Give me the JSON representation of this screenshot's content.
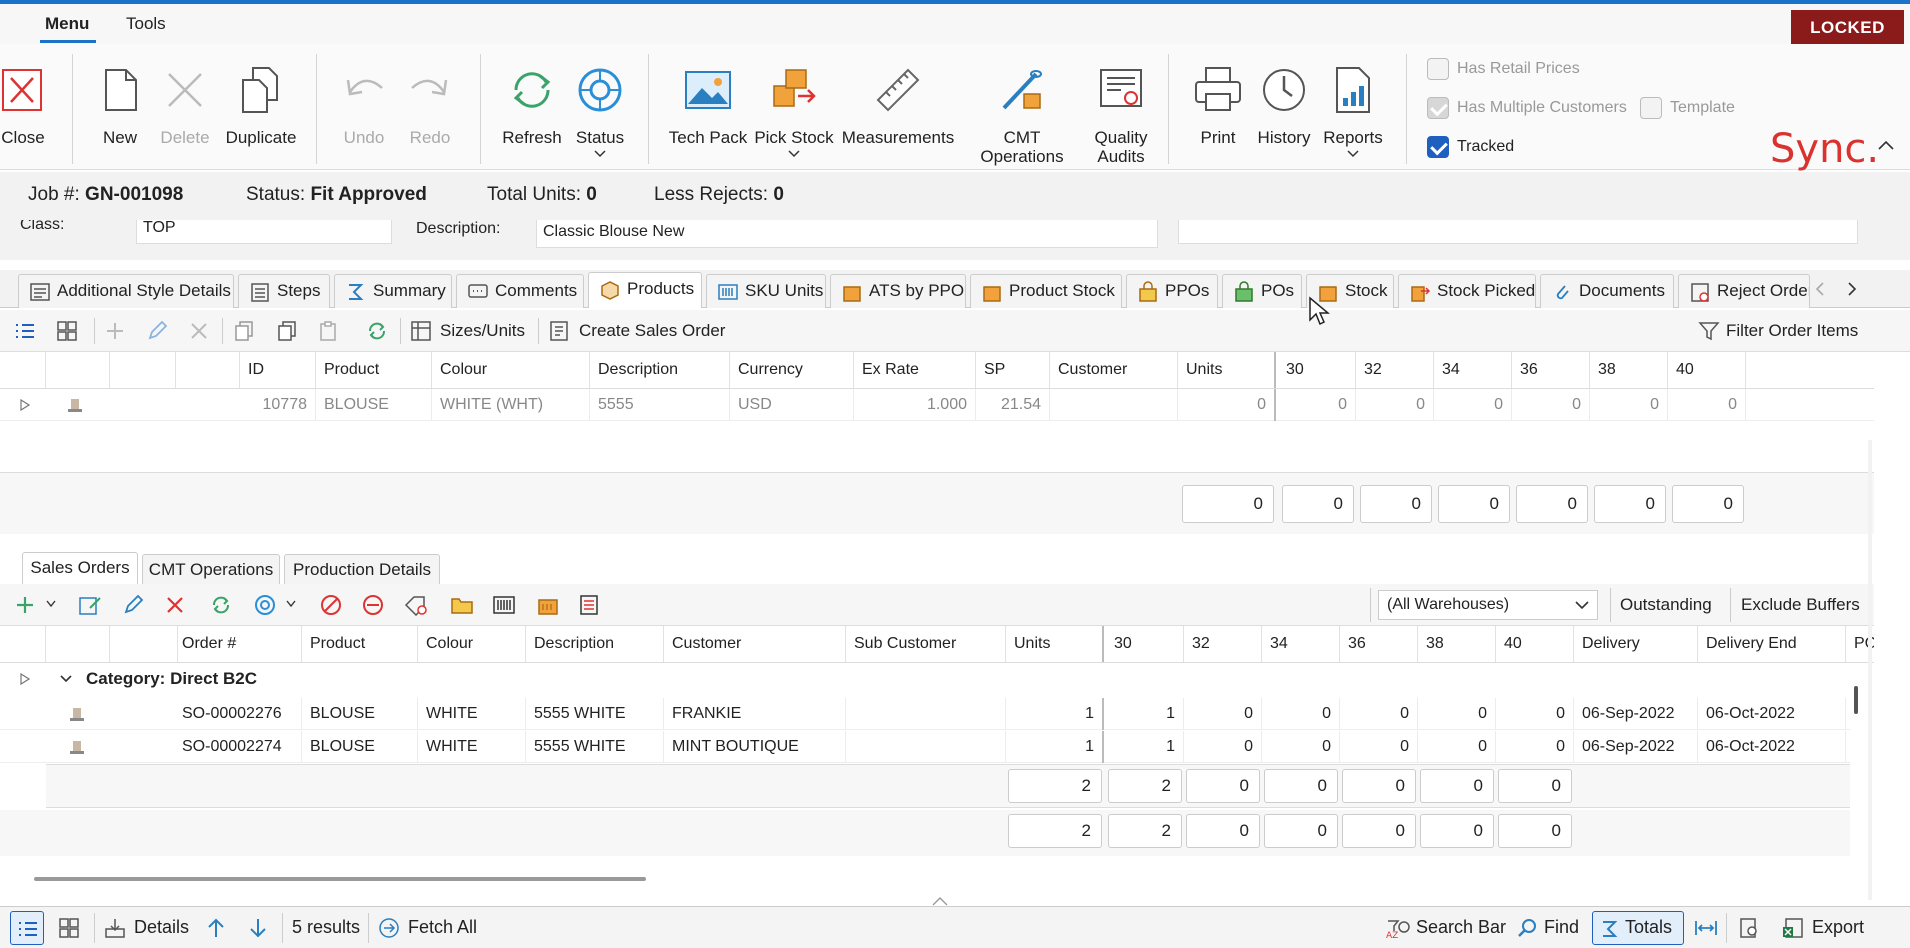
{
  "menubar": {
    "tabs": [
      "Menu",
      "Tools"
    ],
    "locked": "LOCKED"
  },
  "ribbon": {
    "close": "Close",
    "new": "New",
    "delete": "Delete",
    "duplicate": "Duplicate",
    "undo": "Undo",
    "redo": "Redo",
    "refresh": "Refresh",
    "status": "Status",
    "tech_pack": "Tech Pack",
    "pick_stock": "Pick Stock",
    "measurements": "Measurements",
    "cmt_operations": "CMT Operations",
    "quality_line1": "Quality",
    "quality_line2": "Audits",
    "print": "Print",
    "history": "History",
    "reports": "Reports",
    "has_retail_prices": "Has Retail Prices",
    "has_multiple_customers": "Has Multiple Customers",
    "template": "Template",
    "tracked": "Tracked",
    "logo": "Sync."
  },
  "job": {
    "job_label": "Job #:",
    "job_value": "GN-001098",
    "status_label": "Status:",
    "status_value": "Fit Approved",
    "total_label": "Total Units:",
    "total_value": "0",
    "rejects_label": "Less Rejects:",
    "rejects_value": "0",
    "class_label": "Class:",
    "class_value": "TOP",
    "desc_label": "Description:",
    "desc_value": "Classic Blouse New"
  },
  "tabs": [
    "Additional Style Details",
    "Steps",
    "Summary",
    "Comments",
    "Products",
    "SKU Units",
    "ATS by PPO",
    "Product Stock",
    "PPOs",
    "POs",
    "Stock",
    "Stock Picked",
    "Documents",
    "Reject Order"
  ],
  "products_toolbar": {
    "sizes_units": "Sizes/Units",
    "create_sales_order": "Create Sales Order",
    "filter": "Filter Order Items"
  },
  "products_grid": {
    "headers": [
      "ID",
      "Product",
      "Colour",
      "Description",
      "Currency",
      "Ex Rate",
      "SP",
      "Customer",
      "Units",
      "30",
      "32",
      "34",
      "36",
      "38",
      "40"
    ],
    "row": {
      "id": "10778",
      "product": "BLOUSE",
      "colour": "WHITE (WHT)",
      "description": "5555",
      "currency": "USD",
      "ex_rate": "1.000",
      "sp": "21.54",
      "customer": "",
      "units": "0",
      "s30": "0",
      "s32": "0",
      "s34": "0",
      "s36": "0",
      "s38": "0",
      "s40": "0"
    },
    "totals": [
      "0",
      "0",
      "0",
      "0",
      "0",
      "0",
      "0"
    ]
  },
  "sub_tabs": [
    "Sales Orders",
    "CMT Operations",
    "Production Details"
  ],
  "sales_toolbar": {
    "warehouse": "(All Warehouses)",
    "outstanding": "Outstanding",
    "exclude_buffers": "Exclude Buffers"
  },
  "sales_grid": {
    "headers": [
      "Order #",
      "Product",
      "Colour",
      "Description",
      "Customer",
      "Sub Customer",
      "Units",
      "30",
      "32",
      "34",
      "36",
      "38",
      "40",
      "Delivery",
      "Delivery End",
      "PC"
    ],
    "category": "Category: Direct B2C",
    "rows": [
      {
        "order": "SO-00002276",
        "product": "BLOUSE",
        "colour": "WHITE",
        "description": "5555 WHITE",
        "customer": "FRANKIE",
        "sub": "",
        "units": "1",
        "s30": "1",
        "s32": "0",
        "s34": "0",
        "s36": "0",
        "s38": "0",
        "s40": "0",
        "delivery": "06-Sep-2022",
        "delivery_end": "06-Oct-2022"
      },
      {
        "order": "SO-00002274",
        "product": "BLOUSE",
        "colour": "WHITE",
        "description": "5555 WHITE",
        "customer": "MINT BOUTIQUE",
        "sub": "",
        "units": "1",
        "s30": "1",
        "s32": "0",
        "s34": "0",
        "s36": "0",
        "s38": "0",
        "s40": "0",
        "delivery": "06-Sep-2022",
        "delivery_end": "06-Oct-2022"
      }
    ],
    "subtotals": [
      "2",
      "2",
      "0",
      "0",
      "0",
      "0",
      "0"
    ],
    "totals": [
      "2",
      "2",
      "0",
      "0",
      "0",
      "0",
      "0"
    ]
  },
  "statusbar": {
    "details": "Details",
    "results": "5 results",
    "fetch_all": "Fetch All",
    "search_bar": "Search Bar",
    "find": "Find",
    "totals": "Totals",
    "export": "Export"
  }
}
